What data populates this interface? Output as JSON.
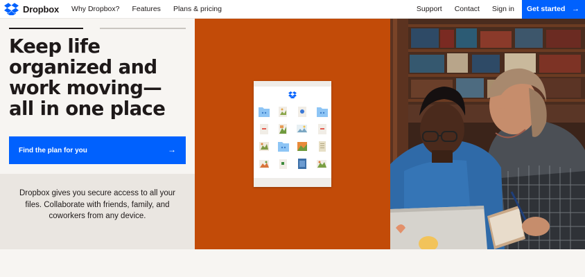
{
  "nav": {
    "brand": "Dropbox",
    "left_links": [
      "Why Dropbox?",
      "Features",
      "Plans & pricing"
    ],
    "right_links": [
      "Support",
      "Contact",
      "Sign in"
    ],
    "cta_label": "Get started",
    "cta_icon": "arrow-right-icon"
  },
  "hero": {
    "headline_lines": [
      "Keep life",
      "organized and",
      "work moving—",
      "all in one place"
    ],
    "plan_button": "Find the plan for you",
    "description": "Dropbox gives you secure access to all your files. Collaborate with friends, family, and coworkers from any device."
  },
  "colors": {
    "brand_blue": "#0061fe",
    "accent_orange": "#c24b08",
    "text_dark": "#1e1919",
    "folder_blue": "#8ec5f5"
  },
  "file_grid": {
    "icons": [
      "folder-icon",
      "image-file-icon",
      "check-file-icon",
      "folder-icon",
      "pdf-file-icon",
      "image-file-icon",
      "image-file-icon",
      "pdf-file-icon",
      "image-file-icon",
      "folder-icon",
      "image-file-icon",
      "document-file-icon",
      "image-file-icon",
      "document-file-icon",
      "image-file-icon",
      "image-file-icon"
    ]
  }
}
